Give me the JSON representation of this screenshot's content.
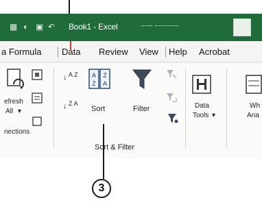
{
  "titlebar": {
    "title": "Book1 - Excel",
    "subtitle": "~~~ ~~~~~~"
  },
  "tabs": [
    {
      "label": "a Formula"
    },
    {
      "label": "Data"
    },
    {
      "label": "Review"
    },
    {
      "label": "View"
    },
    {
      "label": "Help"
    },
    {
      "label": "Acrobat"
    }
  ],
  "ribbon": {
    "queries": {
      "refresh_label": "efresh",
      "all_label": "All",
      "group_label": "nections"
    },
    "sort_filter": {
      "sort_az": "A Z",
      "sort_za": "Z A",
      "sort_label": "Sort",
      "filter_label": "Filter",
      "group_label": "Sort & Filter"
    },
    "data_tools": {
      "label_line1": "Data",
      "label_line2": "Tools",
      "chevron": "▾"
    },
    "what_if": {
      "label_line1": "Wh",
      "label_line2": "Ana"
    }
  },
  "annotation": {
    "step_number": "3"
  },
  "colors": {
    "titlebar": "#1f6b3a",
    "annotation_red": "#c0392b"
  }
}
